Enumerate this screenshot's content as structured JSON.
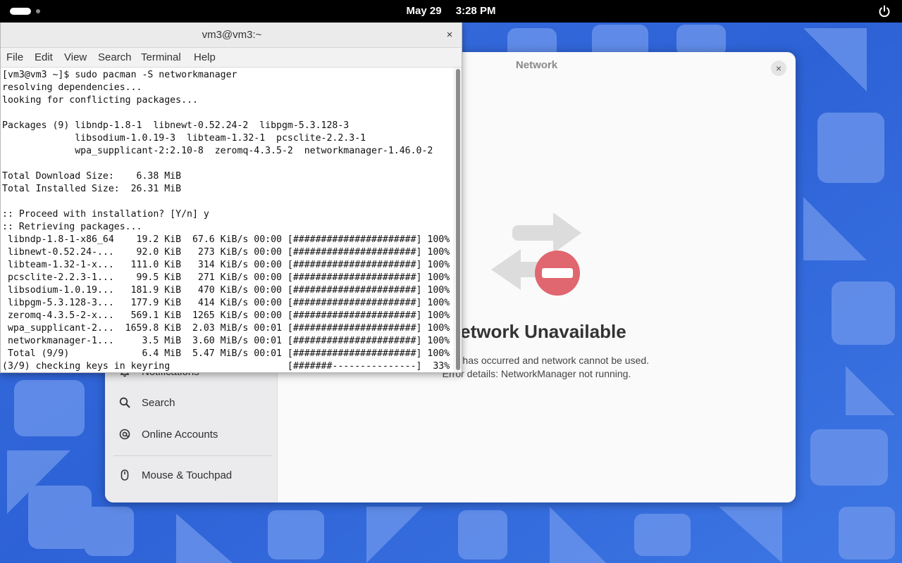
{
  "topbar": {
    "date": "May 29",
    "time": "3:28 PM"
  },
  "settings": {
    "title": "Network",
    "close_label": "×",
    "sidebar": {
      "items": [
        {
          "label": "Notifications",
          "icon": "bell-icon"
        },
        {
          "label": "Search",
          "icon": "search-icon"
        },
        {
          "label": "Online Accounts",
          "icon": "at-icon"
        },
        {
          "label": "Mouse & Touchpad",
          "icon": "mouse-icon"
        }
      ]
    },
    "status": {
      "title": "Network Unavailable",
      "description": "An error has occurred and network cannot be used.",
      "detail": "Error details: NetworkManager not running."
    },
    "colors": {
      "error_red": "#e0666f",
      "arrow_gray": "#dcdcdc"
    }
  },
  "terminal": {
    "title": "vm3@vm3:~",
    "close_label": "×",
    "menu": [
      "File",
      "Edit",
      "View",
      "Search",
      "Terminal",
      "Help"
    ],
    "lines": [
      "[vm3@vm3 ~]$ sudo pacman -S networkmanager",
      "resolving dependencies...",
      "looking for conflicting packages...",
      "",
      "Packages (9) libndp-1.8-1  libnewt-0.52.24-2  libpgm-5.3.128-3",
      "             libsodium-1.0.19-3  libteam-1.32-1  pcsclite-2.2.3-1",
      "             wpa_supplicant-2:2.10-8  zeromq-4.3.5-2  networkmanager-1.46.0-2",
      "",
      "Total Download Size:    6.38 MiB",
      "Total Installed Size:  26.31 MiB",
      "",
      ":: Proceed with installation? [Y/n] y",
      ":: Retrieving packages...",
      " libndp-1.8-1-x86_64    19.2 KiB  67.6 KiB/s 00:00 [######################] 100%",
      " libnewt-0.52.24-...    92.0 KiB   273 KiB/s 00:00 [######################] 100%",
      " libteam-1.32-1-x...   111.0 KiB   314 KiB/s 00:00 [######################] 100%",
      " pcsclite-2.2.3-1...    99.5 KiB   271 KiB/s 00:00 [######################] 100%",
      " libsodium-1.0.19...   181.9 KiB   470 KiB/s 00:00 [######################] 100%",
      " libpgm-5.3.128-3...   177.9 KiB   414 KiB/s 00:00 [######################] 100%",
      " zeromq-4.3.5-2-x...   569.1 KiB  1265 KiB/s 00:00 [######################] 100%",
      " wpa_supplicant-2...  1659.8 KiB  2.03 MiB/s 00:01 [######################] 100%",
      " networkmanager-1...     3.5 MiB  3.60 MiB/s 00:01 [######################] 100%",
      " Total (9/9)             6.4 MiB  5.47 MiB/s 00:01 [######################] 100%",
      "(3/9) checking keys in keyring                     [#######---------------]  33%"
    ]
  }
}
